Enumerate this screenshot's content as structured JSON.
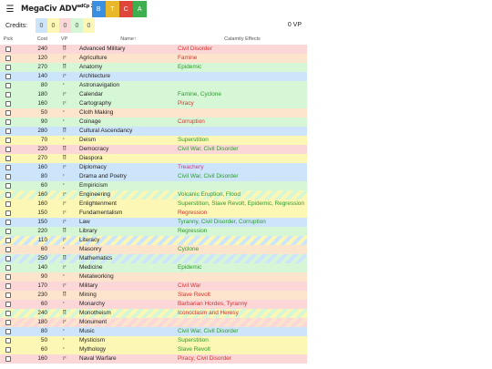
{
  "header": {
    "menu_icon": "hamburger-icon",
    "logo_main": "MegaCiv ADV",
    "logo_sub": "adCp 2023",
    "filters": [
      {
        "label": "B",
        "color": "#3b8fe0"
      },
      {
        "label": "T",
        "color": "#e8b82a"
      },
      {
        "label": "C",
        "color": "#e0453b"
      },
      {
        "label": "A",
        "color": "#3fae4e"
      }
    ]
  },
  "credits": {
    "label": "Credits:",
    "values": [
      {
        "value": "0",
        "color": "#cde5fb"
      },
      {
        "value": "0",
        "color": "#fdf7b5"
      },
      {
        "value": "0",
        "color": "#fcd7d7"
      },
      {
        "value": "0",
        "color": "#d6f7d6"
      },
      {
        "value": "0",
        "color": "#fdf7b5"
      }
    ],
    "vp": "0 VP"
  },
  "columns": {
    "pick": "Pick",
    "cost": "Cost",
    "vp": "VP",
    "name": "Name↑",
    "effects": "Calamity Effects"
  },
  "rows": [
    {
      "cost": "240",
      "vp": "⠿",
      "name": "Advanced Military",
      "effects": "Civil Disorder",
      "bg": "bg-red",
      "eff_color": "#d93030"
    },
    {
      "cost": "120",
      "vp": "⠖",
      "name": "Agriculture",
      "effects": "Famine",
      "bg": "bg-orange",
      "eff_color": "#d93030"
    },
    {
      "cost": "270",
      "vp": "⠿",
      "name": "Anatomy",
      "effects": "Epidemic",
      "bg": "bg-green",
      "eff_color": "#2c9a2c"
    },
    {
      "cost": "140",
      "vp": "⠖",
      "name": "Architecture",
      "effects": "",
      "bg": "bg-blue",
      "eff_color": "#222"
    },
    {
      "cost": "80",
      "vp": "⠂",
      "name": "Astronavigation",
      "effects": "",
      "bg": "bg-green",
      "eff_color": "#222"
    },
    {
      "cost": "180",
      "vp": "⠖",
      "name": "Calendar",
      "effects": "Famine, Cyclone",
      "bg": "bg-green",
      "eff_color": "#2c9a2c"
    },
    {
      "cost": "160",
      "vp": "⠖",
      "name": "Cartography",
      "effects": "Piracy",
      "bg": "bg-green",
      "eff_color": "#d93030"
    },
    {
      "cost": "50",
      "vp": "⠂",
      "name": "Cloth Making",
      "effects": "",
      "bg": "bg-orange",
      "eff_color": "#222"
    },
    {
      "cost": "90",
      "vp": "⠂",
      "name": "Coinage",
      "effects": "Corruption",
      "bg": "bg-green",
      "eff_color": "#d93030"
    },
    {
      "cost": "280",
      "vp": "⠿",
      "name": "Cultural Ascendancy",
      "effects": "",
      "bg": "bg-blue",
      "eff_color": "#222"
    },
    {
      "cost": "70",
      "vp": "⠂",
      "name": "Deism",
      "effects": "Superstition",
      "bg": "bg-yellow",
      "eff_color": "#2c9a2c"
    },
    {
      "cost": "220",
      "vp": "⠿",
      "name": "Democracy",
      "effects": "Civil War, Civil Disorder",
      "bg": "bg-red",
      "eff_color": "#2c9a2c"
    },
    {
      "cost": "270",
      "vp": "⠿",
      "name": "Diaspora",
      "effects": "",
      "bg": "bg-yellow",
      "eff_color": "#222"
    },
    {
      "cost": "160",
      "vp": "⠖",
      "name": "Diplomacy",
      "effects": "Treachery",
      "bg": "bg-blue",
      "eff_color": "#d93080"
    },
    {
      "cost": "80",
      "vp": "⠂",
      "name": "Drama and Poetry",
      "effects": "Civil War, Civil Disorder",
      "bg": "bg-blue",
      "eff_color": "#2c9a2c"
    },
    {
      "cost": "60",
      "vp": "⠂",
      "name": "Empiricism",
      "effects": "",
      "bg": "bg-green",
      "eff_color": "#222"
    },
    {
      "cost": "160",
      "vp": "⠖",
      "name": "Engineering",
      "effects": "Volcanic Eruption, Flood",
      "bg": "bg-stripe-yg",
      "eff_color": "#2c9a2c"
    },
    {
      "cost": "160",
      "vp": "⠖",
      "name": "Enlightenment",
      "effects": "Superstition, Slave Revolt, Epidemic, Regression",
      "bg": "bg-yellow",
      "eff_color": "#2c9a2c",
      "tall": true
    },
    {
      "cost": "150",
      "vp": "⠖",
      "name": "Fundamentalism",
      "effects": "Regression",
      "bg": "bg-yellow",
      "eff_color": "#d93030"
    },
    {
      "cost": "150",
      "vp": "⠖",
      "name": "Law",
      "effects": "Tyranny, Civil Disorder, Corruption",
      "bg": "bg-blue",
      "eff_color": "#2c9a2c"
    },
    {
      "cost": "220",
      "vp": "⠿",
      "name": "Library",
      "effects": "Regression",
      "bg": "bg-green",
      "eff_color": "#2c9a2c"
    },
    {
      "cost": "110",
      "vp": "⠖",
      "name": "Literacy",
      "effects": "",
      "bg": "bg-stripe-by",
      "eff_color": "#222"
    },
    {
      "cost": "60",
      "vp": "⠂",
      "name": "Masonry",
      "effects": "Cyclone",
      "bg": "bg-orange",
      "eff_color": "#2c9a2c"
    },
    {
      "cost": "250",
      "vp": "⠿",
      "name": "Mathematics",
      "effects": "",
      "bg": "bg-stripe-gb",
      "eff_color": "#222"
    },
    {
      "cost": "140",
      "vp": "⠖",
      "name": "Medicine",
      "effects": "Epidemic",
      "bg": "bg-green",
      "eff_color": "#2c9a2c"
    },
    {
      "cost": "90",
      "vp": "⠂",
      "name": "Metalworking",
      "effects": "",
      "bg": "bg-orange",
      "eff_color": "#222"
    },
    {
      "cost": "170",
      "vp": "⠖",
      "name": "Military",
      "effects": "Civil War",
      "bg": "bg-red",
      "eff_color": "#d93030"
    },
    {
      "cost": "230",
      "vp": "⠿",
      "name": "Mining",
      "effects": "Slave Revolt",
      "bg": "bg-orange",
      "eff_color": "#d93030"
    },
    {
      "cost": "60",
      "vp": "⠂",
      "name": "Monarchy",
      "effects": "Barbarian Hordes, Tyranny",
      "bg": "bg-red",
      "eff_color": "#d93030"
    },
    {
      "cost": "240",
      "vp": "⠿",
      "name": "Monotheism",
      "effects": "Iconoclasm and Heresy",
      "bg": "bg-stripe-yg",
      "eff_color": "#d93030"
    },
    {
      "cost": "180",
      "vp": "⠖",
      "name": "Monument",
      "effects": "",
      "bg": "bg-stripe-or",
      "eff_color": "#222"
    },
    {
      "cost": "80",
      "vp": "⠂",
      "name": "Music",
      "effects": "Civil War, Civil Disorder",
      "bg": "bg-blue",
      "eff_color": "#2c9a2c"
    },
    {
      "cost": "50",
      "vp": "⠂",
      "name": "Mysticism",
      "effects": "Superstition",
      "bg": "bg-yellow",
      "eff_color": "#2c9a2c"
    },
    {
      "cost": "60",
      "vp": "⠂",
      "name": "Mythology",
      "effects": "Slave Revolt",
      "bg": "bg-yellow",
      "eff_color": "#2c9a2c"
    },
    {
      "cost": "160",
      "vp": "⠖",
      "name": "Naval Warfare",
      "effects": "Piracy, Civil Disorder",
      "bg": "bg-red",
      "eff_color": "#d93030"
    }
  ]
}
